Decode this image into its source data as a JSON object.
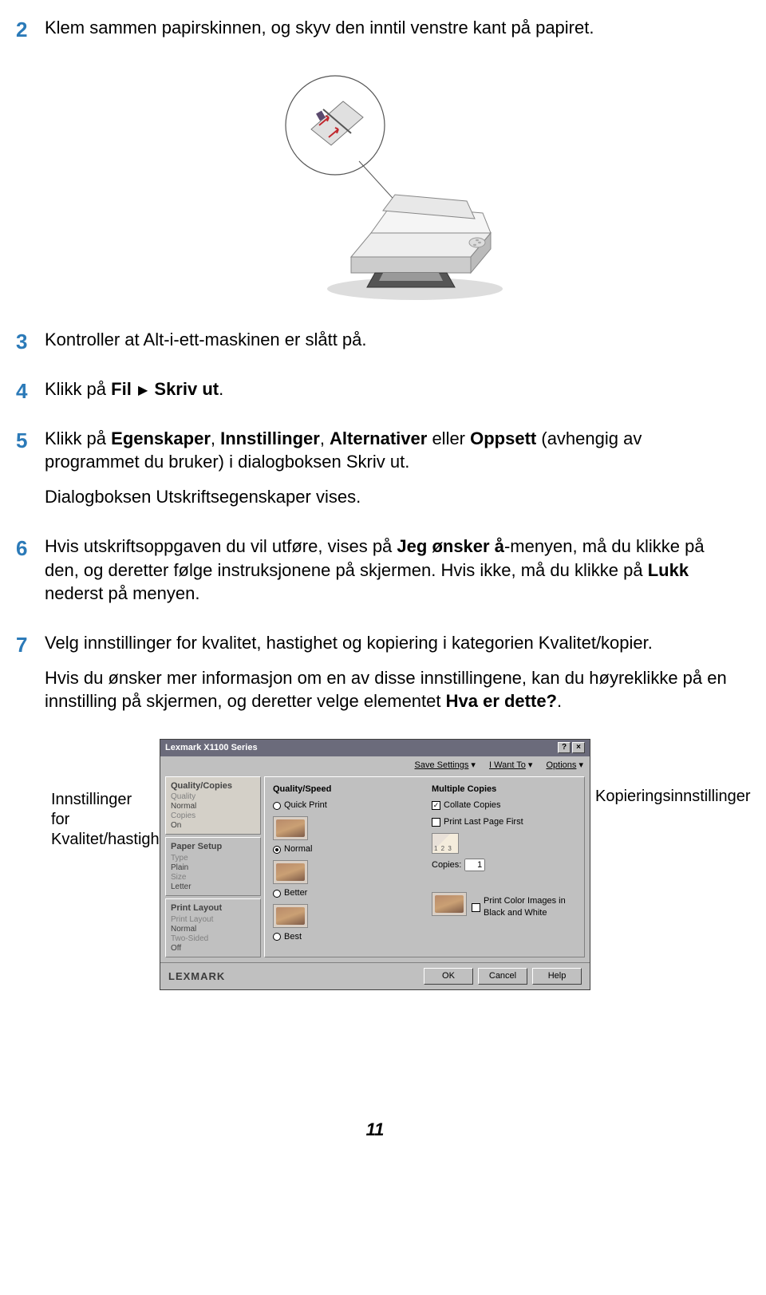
{
  "steps": {
    "s2": {
      "num": "2",
      "text": "Klem sammen papirskinnen, og skyv den inntil venstre kant på papiret."
    },
    "s3": {
      "num": "3",
      "text": "Kontroller at Alt-i-ett-maskinen er slått på."
    },
    "s4": {
      "num": "4",
      "pre": "Klikk på ",
      "b1": "Fil",
      "mid": " ",
      "b2": "Skriv ut",
      "post": "."
    },
    "s5": {
      "num": "5",
      "pre": "Klikk på ",
      "b1": "Egenskaper",
      "mid1": ", ",
      "b2": "Innstillinger",
      "mid2": ", ",
      "b3": "Alternativer",
      "mid3": " eller ",
      "b4": "Oppsett",
      "post": " (avhengig av programmet du bruker) i dialogboksen Skriv ut.",
      "p2": "Dialogboksen Utskriftsegenskaper vises."
    },
    "s6": {
      "num": "6",
      "pre": "Hvis utskriftsoppgaven du vil utføre, vises på ",
      "b1": "Jeg ønsker å",
      "mid": "-menyen, må du klikke på den, og deretter følge instruksjonene på skjermen. Hvis ikke, må du klikke på ",
      "b2": "Lukk",
      "post": " nederst på menyen."
    },
    "s7": {
      "num": "7",
      "p1": "Velg innstillinger for kvalitet, hastighet og kopiering i kategorien Kvalitet/kopier.",
      "p2_pre": "Hvis du ønsker mer informasjon om en av disse innstillingene, kan du høyreklikke på en innstilling på skjermen, og deretter velge elementet ",
      "p2_b": "Hva er dette?",
      "p2_post": "."
    }
  },
  "side_labels": {
    "left": "Innstillinger for Kvalitet/hastighet",
    "right": "Kopieringsinnstillinger"
  },
  "dialog": {
    "title": "Lexmark X1100 Series",
    "top_links": {
      "save": "Save Settings",
      "want": "I Want To",
      "options": "Options"
    },
    "tabs": {
      "qc": {
        "title": "Quality/Copies",
        "l1": "Quality",
        "l2": "Normal",
        "l3": "Copies",
        "l4": "On"
      },
      "ps": {
        "title": "Paper Setup",
        "l1": "Type",
        "l2": "Plain",
        "l3": "Size",
        "l4": "Letter"
      },
      "pl": {
        "title": "Print Layout",
        "l1": "Print Layout",
        "l2": "Normal",
        "l3": "Two-Sided",
        "l4": "Off"
      }
    },
    "qs": {
      "header": "Quality/Speed",
      "quick": "Quick Print",
      "normal": "Normal",
      "better": "Better",
      "best": "Best"
    },
    "mc": {
      "header": "Multiple Copies",
      "collate": "Collate Copies",
      "lastfirst": "Print Last Page First",
      "copies_label": "Copies:",
      "copies_value": "1",
      "colorimg": "Print Color Images in Black and White"
    },
    "brand": "LEXMARK",
    "buttons": {
      "ok": "OK",
      "cancel": "Cancel",
      "help": "Help"
    }
  },
  "page_number": "11"
}
